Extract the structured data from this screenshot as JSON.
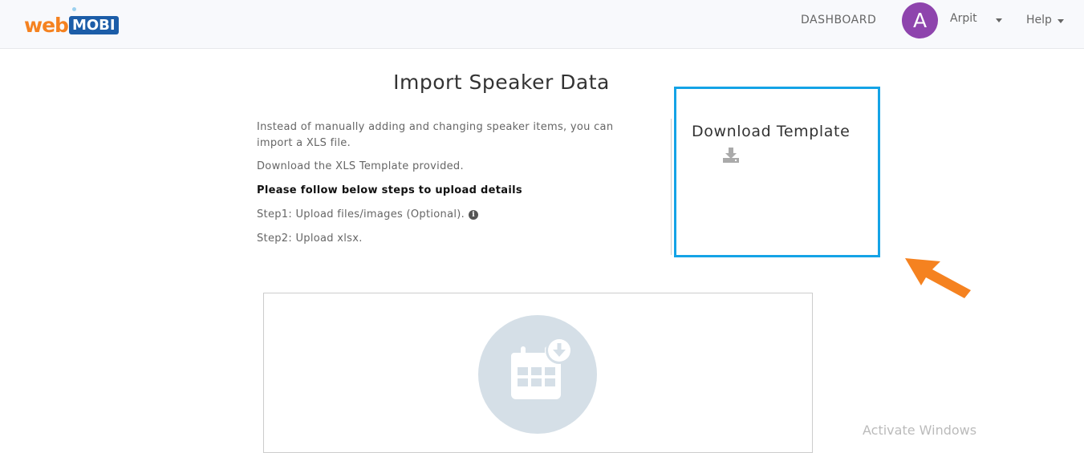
{
  "header": {
    "logo_web": "web",
    "logo_mobi": "MOBI",
    "nav_dashboard": "DASHBOARD",
    "avatar_letter": "A",
    "user_name": "Arpit",
    "help_label": "Help"
  },
  "main": {
    "title": "Import Speaker Data",
    "intro": "Instead of manually adding and changing speaker items, you can import a XLS file.",
    "template_text": "Download the XLS Template provided.",
    "steps_heading": "Please follow below steps to upload details",
    "step1": "Step1: Upload files/images (Optional).",
    "step2": "Step2: Upload xlsx."
  },
  "template_panel": {
    "title": "Download Template",
    "icon": "download-icon"
  },
  "upload_panel": {
    "icon": "calendar-download-icon"
  },
  "watermark": "Activate Windows",
  "colors": {
    "brand_orange": "#f58220",
    "brand_blue": "#1c5da8",
    "highlight_border": "#14a3e6",
    "avatar": "#8e44ad",
    "arrow": "#f58220"
  }
}
